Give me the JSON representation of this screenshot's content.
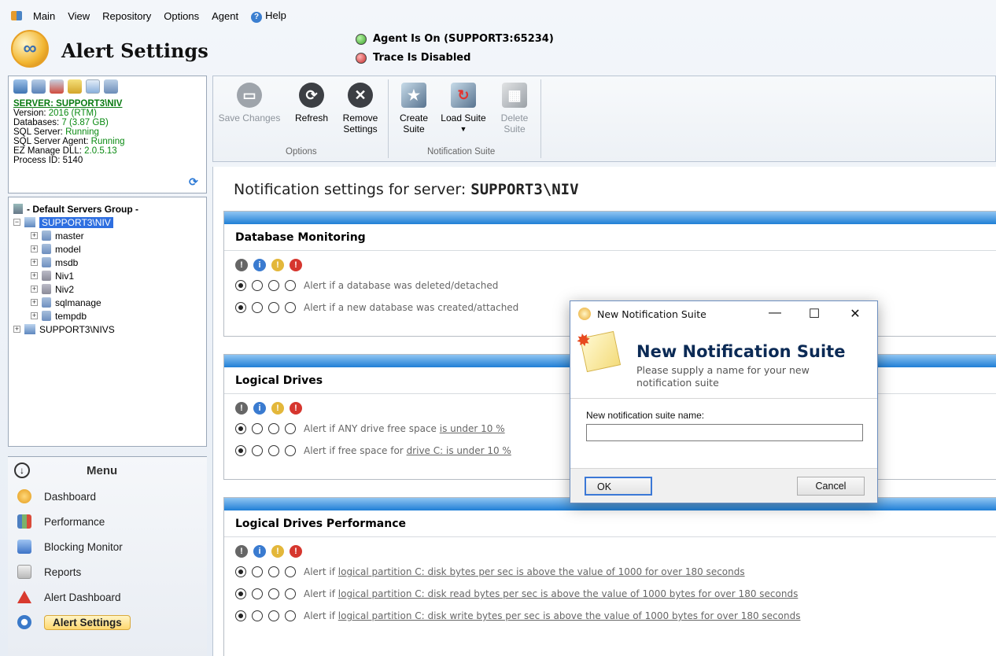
{
  "menubar": {
    "items": [
      "Main",
      "View",
      "Repository",
      "Options",
      "Agent",
      "Help"
    ]
  },
  "header": {
    "app_title": "Alert Settings",
    "agent_status": "Agent Is On (SUPPORT3:65234)",
    "trace_status": "Trace Is Disabled"
  },
  "server_info": {
    "server_label": "SERVER: SUPPORT3\\NIV",
    "version_label": "Version:",
    "version_value": "2016 (RTM)",
    "databases_label": "Databases:",
    "databases_value": "7 (3.87 GB)",
    "sql_server_label": "SQL Server:",
    "sql_server_value": "Running",
    "sql_agent_label": "SQL Server Agent:",
    "sql_agent_value": "Running",
    "dll_label": "EZ Manage DLL:",
    "dll_value": "2.0.5.13",
    "process_label": "Process ID:",
    "process_value": "5140"
  },
  "tree": {
    "group": "- Default Servers Group -",
    "servers": [
      {
        "name": "SUPPORT3\\NIV",
        "databases": [
          "master",
          "model",
          "msdb",
          "Niv1",
          "Niv2",
          "sqlmanage",
          "tempdb"
        ]
      },
      {
        "name": "SUPPORT3\\NIVS"
      }
    ]
  },
  "menu": {
    "title": "Menu",
    "items": [
      "Dashboard",
      "Performance",
      "Blocking Monitor",
      "Reports",
      "Alert Dashboard",
      "Alert Settings"
    ]
  },
  "ribbon": {
    "save_label": "Save Changes",
    "refresh_label": "Refresh",
    "remove_label_1": "Remove",
    "remove_label_2": "Settings",
    "options_group": "Options",
    "create_label_1": "Create",
    "create_label_2": "Suite",
    "load_label": "Load Suite",
    "delete_label_1": "Delete",
    "delete_label_2": "Suite",
    "suite_group": "Notification Suite"
  },
  "content": {
    "title_prefix": "Notification settings for server: ",
    "title_server": "SUPPORT3\\NIV",
    "sections": [
      {
        "title": "Database Monitoring",
        "alerts": [
          {
            "text": "Alert if a database was deleted/detached"
          },
          {
            "text": "Alert if a new database was created/attached"
          }
        ]
      },
      {
        "title": "Logical Drives",
        "alerts": [
          {
            "pre": "Alert if ANY drive free space ",
            "link": "is under 10 %"
          },
          {
            "pre": "Alert if free space for ",
            "link": "drive C: is under 10 %"
          }
        ]
      },
      {
        "title": "Logical Drives Performance",
        "alerts": [
          {
            "pre": "Alert if ",
            "link": "logical partition C: disk bytes per sec is above the value of 1000 for over 180 seconds"
          },
          {
            "pre": "Alert if ",
            "link": "logical partition C: disk read bytes per sec is above the value of 1000 bytes for over 180 seconds"
          },
          {
            "pre": "Alert if ",
            "link": "logical partition C: disk write bytes per sec is above the value of 1000 bytes for over 180 seconds"
          }
        ]
      }
    ]
  },
  "dialog": {
    "window_title": "New Notification Suite",
    "heading": "New Notification Suite",
    "subtitle": "Please supply a name for your new notification suite",
    "field_label": "New notification suite name:",
    "field_value": "",
    "ok_label": "OK",
    "cancel_label": "Cancel"
  }
}
